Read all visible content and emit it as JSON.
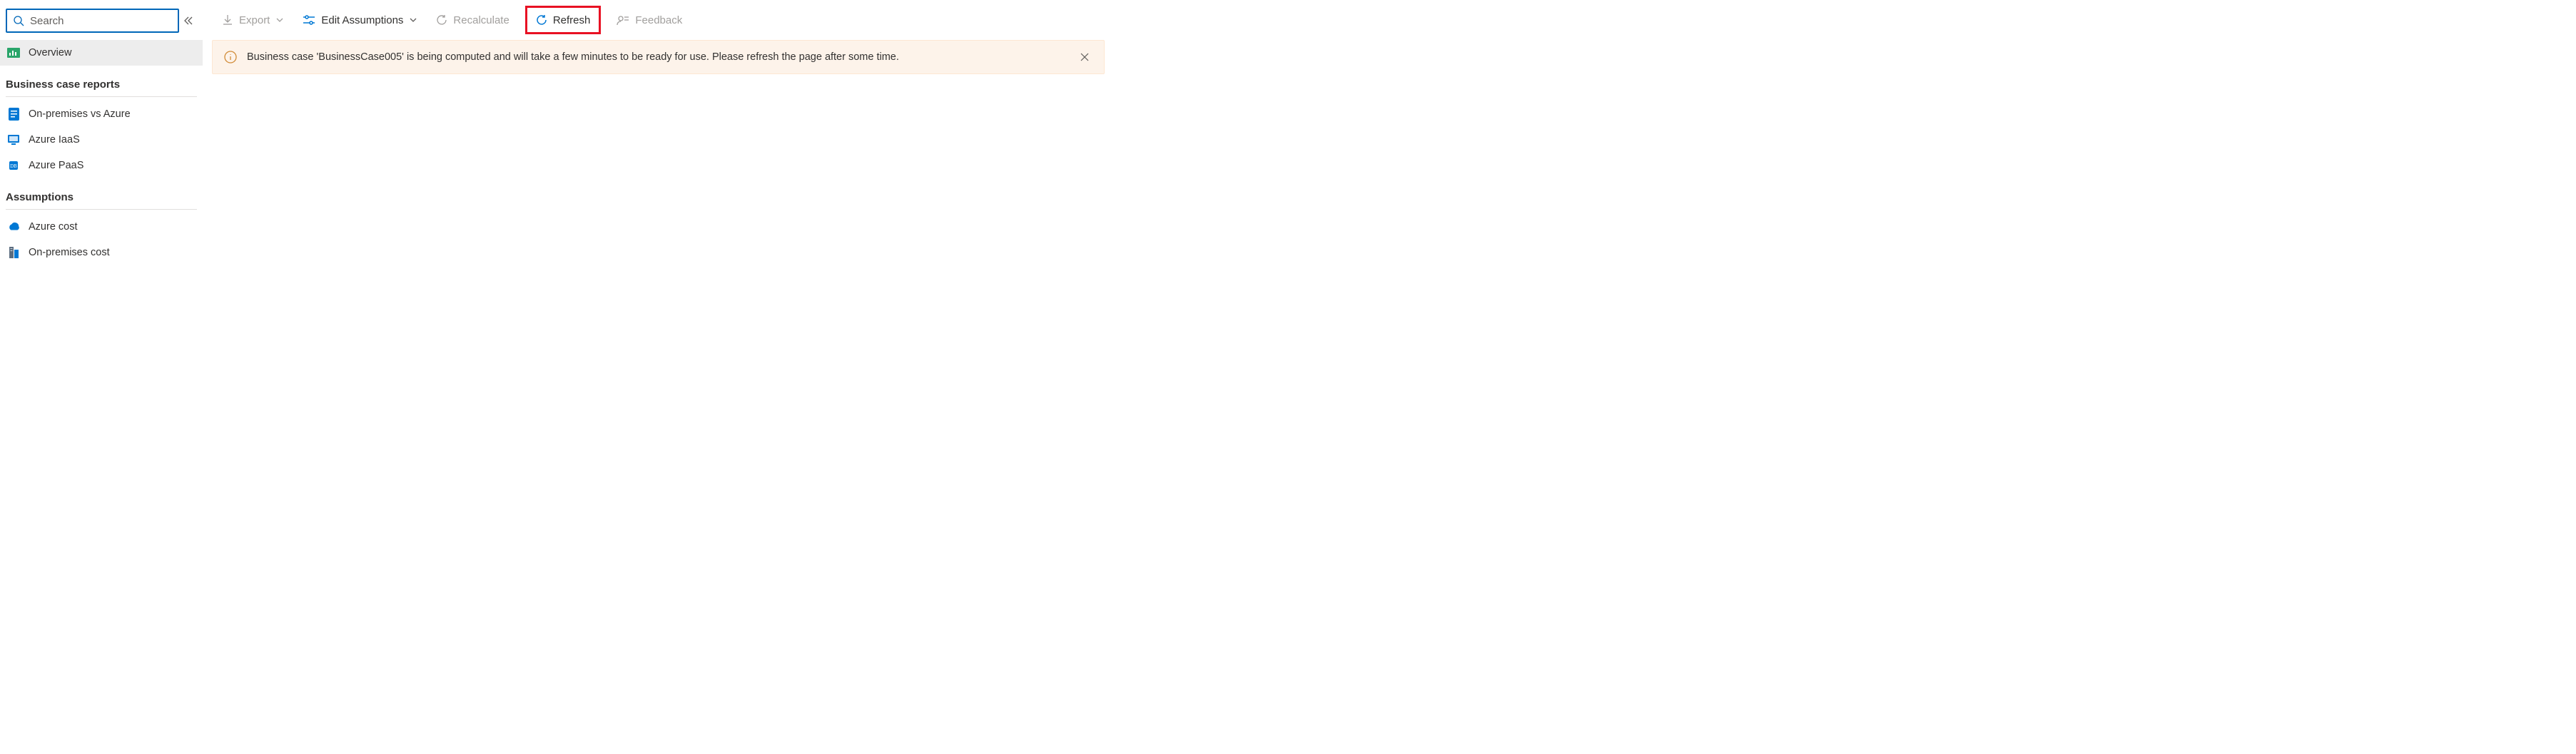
{
  "search": {
    "placeholder": "Search"
  },
  "sidebar": {
    "overview": "Overview",
    "section_reports": "Business case reports",
    "items_reports": [
      {
        "label": "On-premises vs Azure"
      },
      {
        "label": "Azure IaaS"
      },
      {
        "label": "Azure PaaS"
      }
    ],
    "section_assumptions": "Assumptions",
    "items_assumptions": [
      {
        "label": "Azure cost"
      },
      {
        "label": "On-premises cost"
      }
    ]
  },
  "toolbar": {
    "export": "Export",
    "edit_assumptions": "Edit Assumptions",
    "recalculate": "Recalculate",
    "refresh": "Refresh",
    "feedback": "Feedback"
  },
  "banner": {
    "message": "Business case 'BusinessCase005' is being computed and will take a few minutes to be ready for use. Please refresh the page after some time."
  }
}
